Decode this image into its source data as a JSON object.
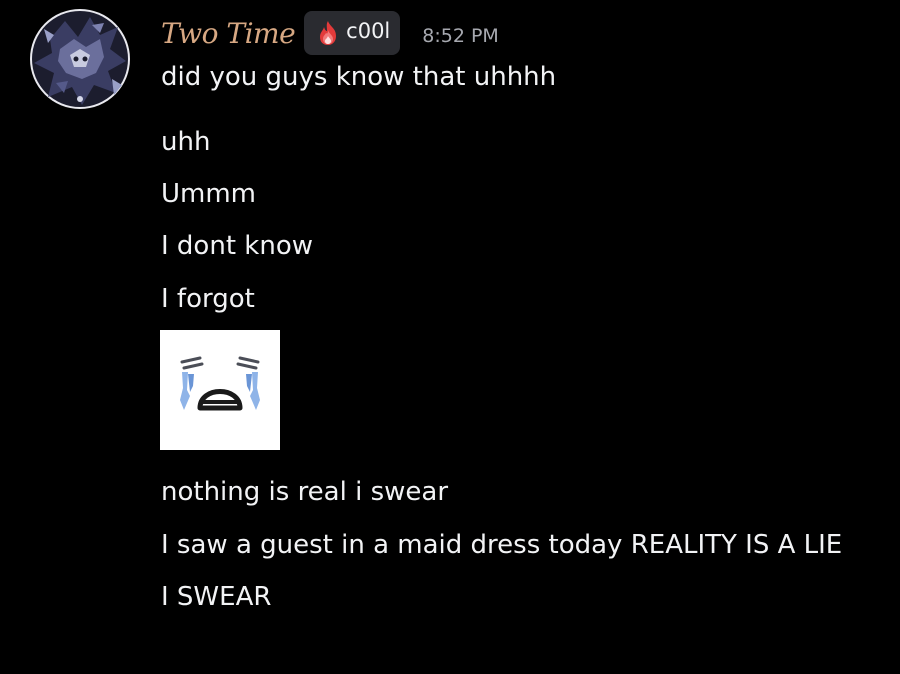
{
  "message": {
    "author": "Two Time",
    "role_tag": "c00l",
    "timestamp": "8:52 PM",
    "lines": [
      "did you guys know that uhhhh",
      "uhh",
      "Ummm",
      "I dont know",
      "I forgot",
      "nothing is real i swear",
      "I saw a guest in a maid dress today REALITY IS A LIE",
      "I SWEAR"
    ],
    "attachment_icon": "crying-face-emoji",
    "avatar_icon": "dark-character-avatar",
    "role_icon": "fire-icon"
  },
  "colors": {
    "background": "#000000",
    "username": "#d7a883",
    "text": "#f2f3f5",
    "timestamp": "#a7a9b0",
    "role_tag_bg": "#2a2b30",
    "tears": "#8fb4e8"
  }
}
